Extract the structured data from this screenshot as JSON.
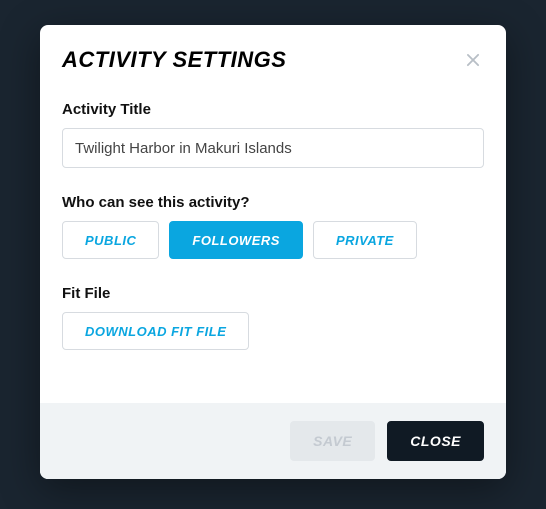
{
  "modal": {
    "title": "ACTIVITY SETTINGS",
    "fields": {
      "activity_title": {
        "label": "Activity Title",
        "value": "Twilight Harbor in Makuri Islands"
      },
      "visibility": {
        "label": "Who can see this activity?",
        "options": {
          "public": "PUBLIC",
          "followers": "FOLLOWERS",
          "private": "PRIVATE"
        },
        "selected": "followers"
      },
      "fit_file": {
        "label": "Fit File",
        "download_label": "DOWNLOAD FIT FILE"
      }
    },
    "footer": {
      "save_label": "SAVE",
      "close_label": "CLOSE"
    }
  },
  "colors": {
    "accent": "#0aa6e0",
    "dark": "#101a24",
    "muted_bg": "#f0f3f5"
  }
}
